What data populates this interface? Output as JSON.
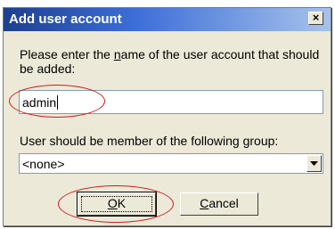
{
  "window": {
    "title": "Add user account",
    "close_glyph": "×"
  },
  "form": {
    "name_label_pre": "Please enter the ",
    "name_label_accel": "n",
    "name_label_post": "ame of the user account that should be added:",
    "name_value": "admin",
    "group_label_pre": "User should be member of the following ",
    "group_label_accel": "g",
    "group_label_post": "roup:",
    "group_value": "<none>"
  },
  "buttons": {
    "ok_accel": "O",
    "ok_rest": "K",
    "cancel_accel": "C",
    "cancel_rest": "ancel"
  },
  "icons": {
    "close": "close-icon",
    "dropdown": "chevron-down-icon"
  },
  "colors": {
    "titlebar_start": "#1d3f8f",
    "titlebar_end": "#a7c2ec",
    "dialog_bg": "#ece9d8",
    "annotation": "#d21a1a"
  }
}
